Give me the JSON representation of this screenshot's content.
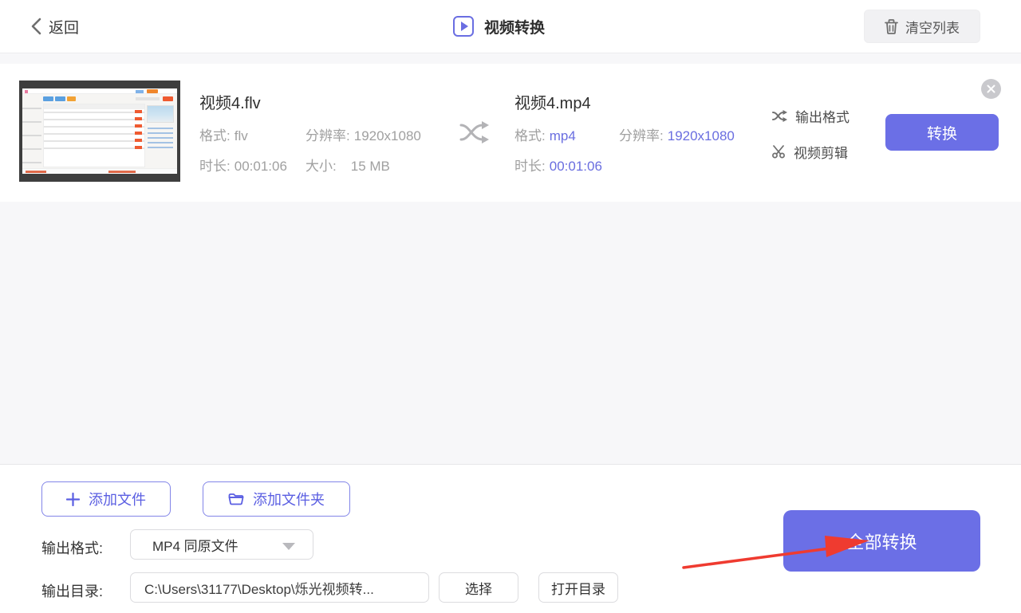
{
  "header": {
    "back_label": "返回",
    "title": "视频转换",
    "clear_list_label": "清空列表"
  },
  "file_item": {
    "source": {
      "name": "视频4.flv",
      "format_label": "格式:",
      "format_value": "flv",
      "resolution_label": "分辨率:",
      "resolution_value": "1920x1080",
      "duration_label": "时长:",
      "duration_value": "00:01:06",
      "size_label": "大小:",
      "size_value": "15 MB"
    },
    "output": {
      "name": "视频4.mp4",
      "format_label": "格式:",
      "format_value": "mp4",
      "resolution_label": "分辨率:",
      "resolution_value": "1920x1080",
      "duration_label": "时长:",
      "duration_value": "00:01:06"
    },
    "output_format_label": "输出格式",
    "video_trim_label": "视频剪辑",
    "convert_label": "转换"
  },
  "footer": {
    "add_file_label": "添加文件",
    "add_folder_label": "添加文件夹",
    "output_format_label": "输出格式:",
    "output_format_value": "MP4 同原文件",
    "output_dir_label": "输出目录:",
    "output_dir_value": "C:\\Users\\31177\\Desktop\\烁光视频转...",
    "choose_label": "选择",
    "open_dir_label": "打开目录",
    "convert_all_label": "全部转换"
  },
  "colors": {
    "accent": "#6b6fe6",
    "accent_text": "#6a6ee0",
    "annotation_arrow": "#ef3b30"
  }
}
